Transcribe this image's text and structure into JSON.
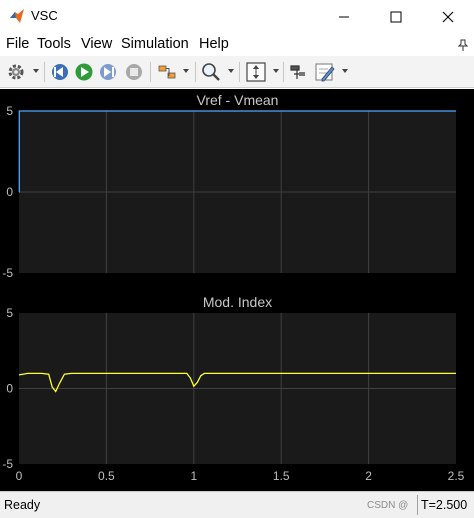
{
  "window": {
    "title": "VSC"
  },
  "menu": [
    "File",
    "Tools",
    "View",
    "Simulation",
    "Help"
  ],
  "toolbar": {
    "icons": [
      "gear-icon",
      "step-back-icon",
      "run-icon",
      "step-forward-icon",
      "stop-icon",
      "highlight-icon",
      "zoom-icon",
      "fit-icon",
      "cursor-measure-icon",
      "properties-icon"
    ]
  },
  "colors": {
    "bg": "#000000",
    "axes": "#1a1a1a",
    "grid": "#404040",
    "axis_text": "#bfbfbf",
    "title_text": "#c8c8c8",
    "series1": "#4da6ff",
    "series2": "#ffff2e"
  },
  "chart_data": [
    {
      "type": "line",
      "title": "Vref - Vmean",
      "xlim": [
        0,
        2.5
      ],
      "ylim": [
        -5,
        5
      ],
      "yticks": [
        "5",
        "0",
        "-5"
      ],
      "xticks": [],
      "grid": true,
      "series": [
        {
          "x": [
            0,
            0.002,
            0.002,
            2.5
          ],
          "y": [
            0,
            0,
            5,
            5
          ]
        }
      ]
    },
    {
      "type": "line",
      "title": "Mod. Index",
      "xlim": [
        0,
        2.5
      ],
      "ylim": [
        -5,
        5
      ],
      "yticks": [
        "5",
        "0",
        "-5"
      ],
      "xticks": [
        "0",
        "0.5",
        "1",
        "1.5",
        "2",
        "2.5"
      ],
      "grid": true,
      "series": [
        {
          "x": [
            0,
            0.05,
            0.13,
            0.17,
            0.19,
            0.21,
            0.23,
            0.26,
            0.3,
            0.96,
            0.98,
            1.0,
            1.02,
            1.04,
            1.06,
            2.5
          ],
          "y": [
            0.9,
            1.0,
            1.0,
            0.95,
            0.1,
            -0.2,
            0.3,
            0.95,
            1.0,
            1.0,
            0.7,
            0.15,
            0.4,
            0.85,
            1.0,
            1.0
          ]
        }
      ]
    }
  ],
  "status": {
    "text": "Ready",
    "time": "T=2.500"
  },
  "watermark": "CSDN @"
}
